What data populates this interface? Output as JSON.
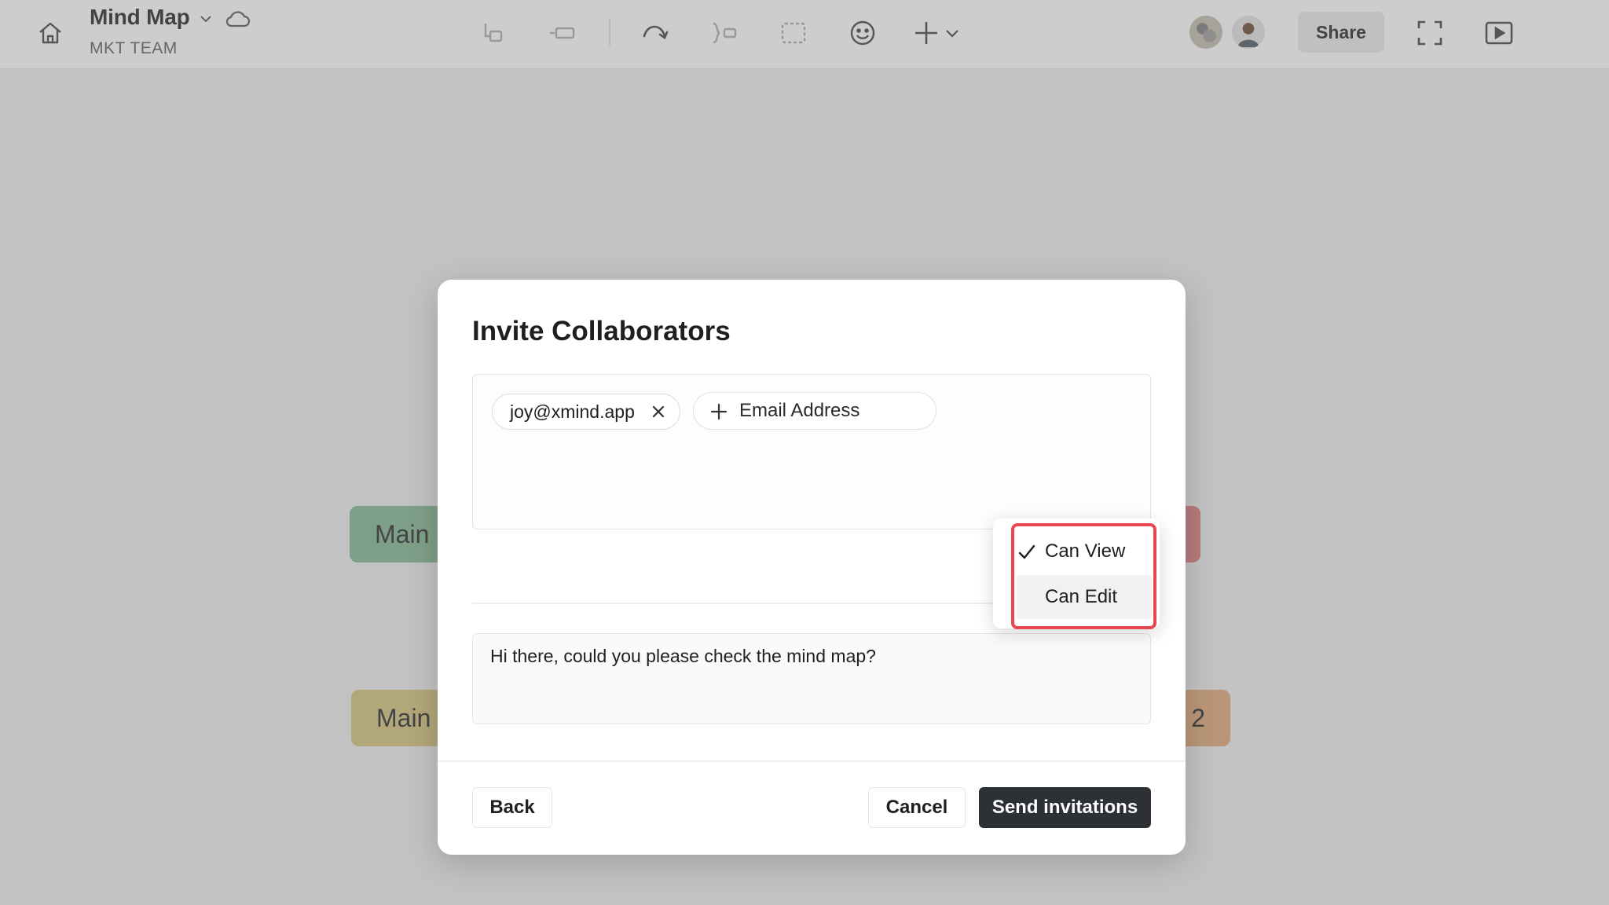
{
  "toolbar": {
    "doc_title": "Mind Map",
    "team_name": "MKT TEAM",
    "share_label": "Share",
    "tools": [
      "subtopic-icon",
      "topic-icon",
      "relationship-icon",
      "summary-icon",
      "boundary-icon",
      "emoji-icon",
      "insert-icon"
    ]
  },
  "canvas": {
    "nodes": [
      {
        "label": "Main",
        "color": "#8fbd9d"
      },
      {
        "label": "Main",
        "color": "#d9c98a"
      },
      {
        "label": "",
        "color": "#e08a8a"
      },
      {
        "label": "2",
        "color": "#e3b186"
      }
    ]
  },
  "modal": {
    "title": "Invite Collaborators",
    "email_chip": "joy@xmind.app",
    "add_email_label": "Email Address",
    "message": "Hi there, could you please check the mind map?",
    "back_label": "Back",
    "cancel_label": "Cancel",
    "send_label": "Send invitations"
  },
  "permission_menu": {
    "selected": "Can View",
    "options": [
      "Can View",
      "Can Edit"
    ]
  },
  "colors": {
    "primary_button": "#2d3136",
    "highlight": "#e8474f"
  }
}
